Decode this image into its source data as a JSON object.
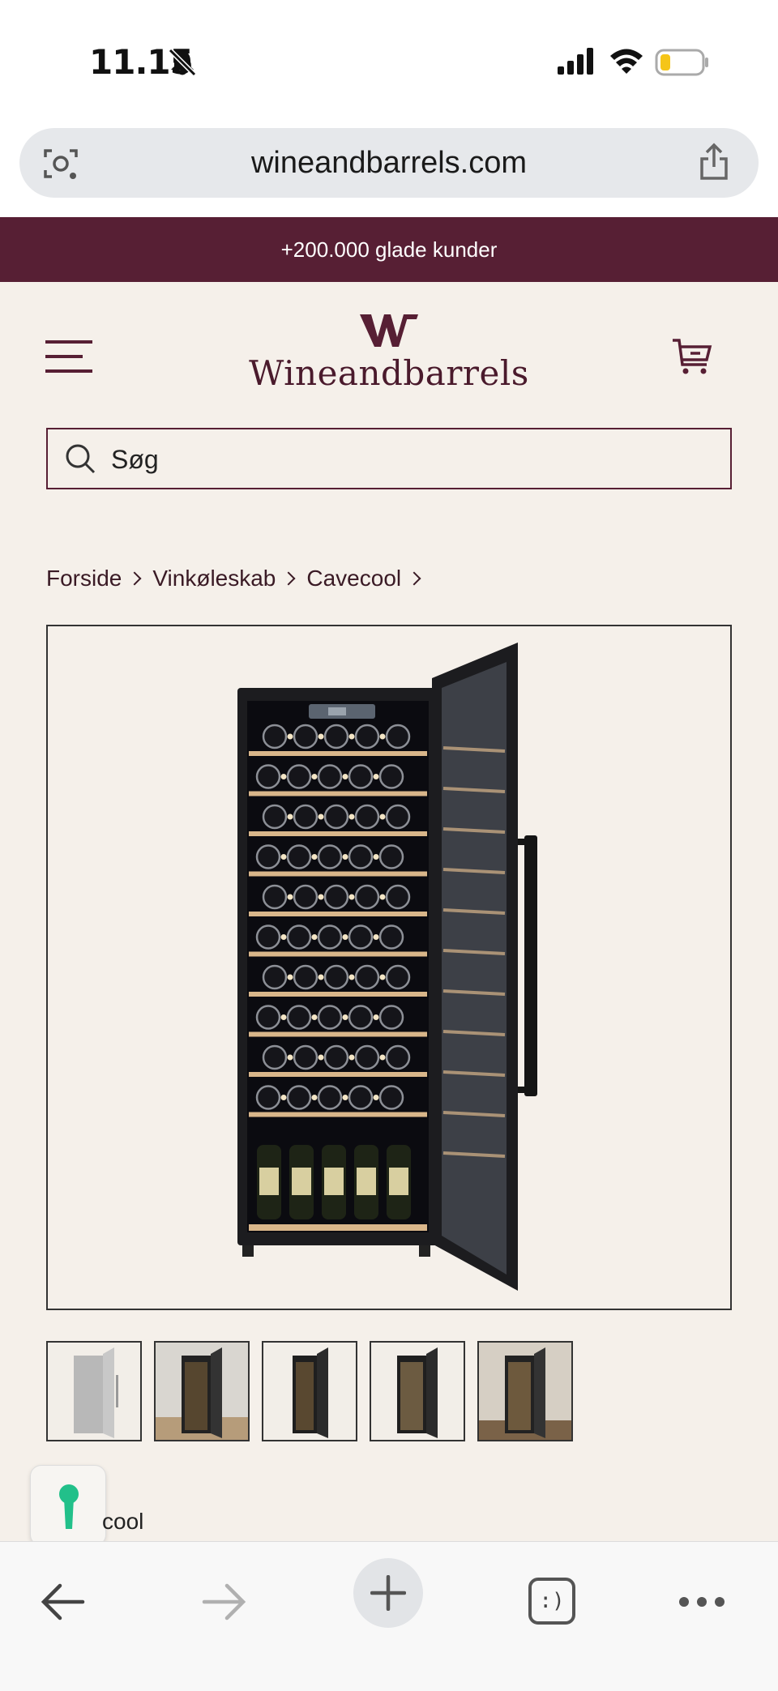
{
  "status_bar": {
    "time": "11.15"
  },
  "browser": {
    "url": "wineandbarrels.com"
  },
  "promo": {
    "text": "+200.000 glade kunder"
  },
  "header": {
    "logo_text": "Wineandbarrels"
  },
  "search": {
    "placeholder": "Søg"
  },
  "breadcrumb": [
    {
      "label": "Forside"
    },
    {
      "label": "Vinkøleskab"
    },
    {
      "label": "Cavecool"
    }
  ],
  "product": {
    "thumbnail_count": 5,
    "partial_title": "cool"
  },
  "colors": {
    "brand": "#571f34",
    "background": "#f5f0ea",
    "badge_key": "#22c08a"
  }
}
